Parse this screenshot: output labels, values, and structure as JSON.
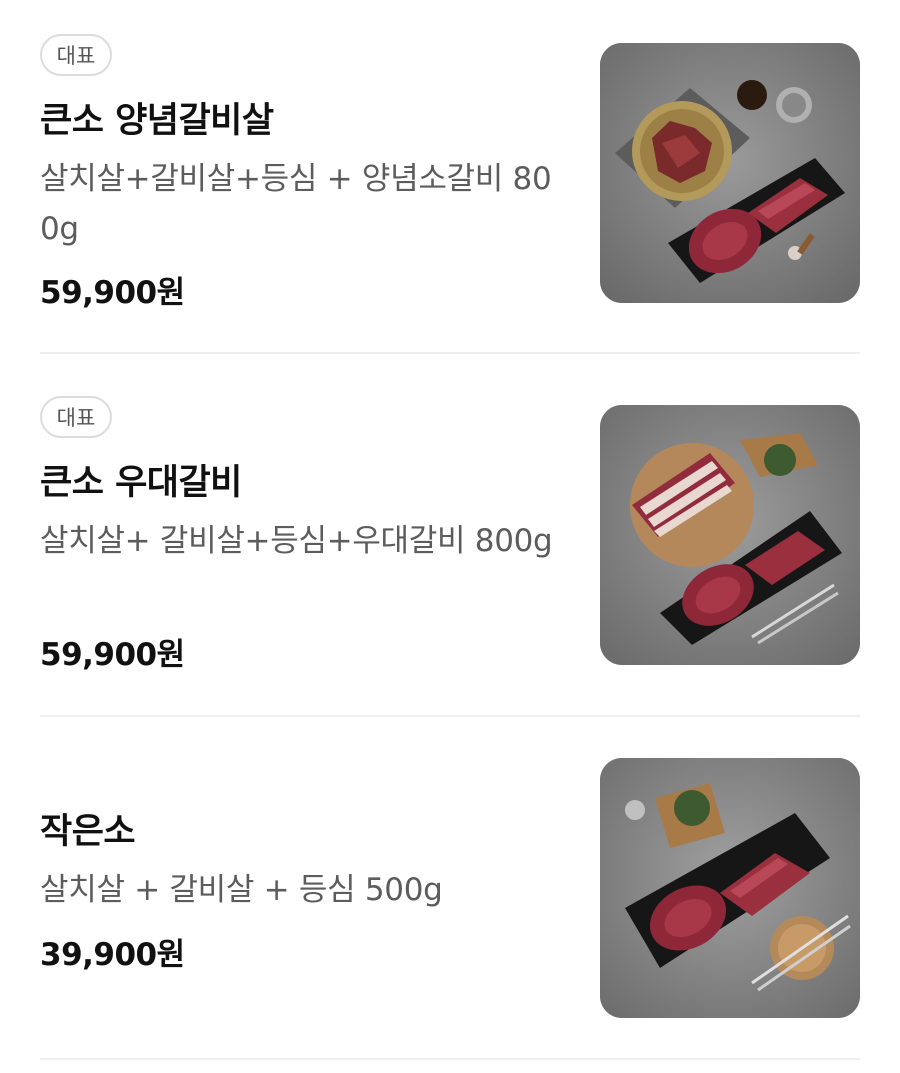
{
  "menu": {
    "items": [
      {
        "badge": "대표",
        "name": "큰소 양념갈비살",
        "description": "살치살+갈비살+등심 + 양념소갈비 800g",
        "price": "59,900원"
      },
      {
        "badge": "대표",
        "name": "큰소 우대갈비",
        "description": "살치살+ 갈비살+등심+우대갈비 800g",
        "price": "59,900원"
      },
      {
        "name": "작은소",
        "description": "살치살 + 갈비살 + 등심 500g",
        "price": "39,900원"
      }
    ]
  }
}
